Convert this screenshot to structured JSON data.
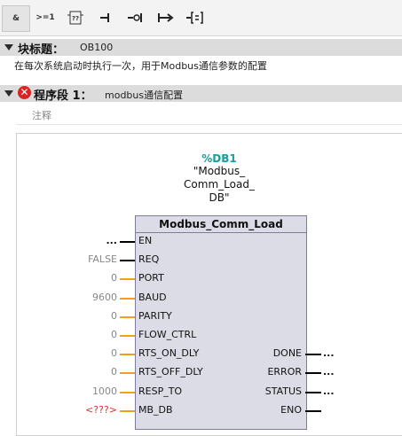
{
  "toolbar": {
    "buttons": [
      {
        "label": "&",
        "icon": "and-icon"
      },
      {
        "label": ">=1",
        "icon": "or-icon"
      },
      {
        "label": "[??]",
        "icon": "empty-box-icon"
      },
      {
        "label": "-|",
        "icon": "open-branch-icon"
      },
      {
        "label": "--o|",
        "icon": "negate-icon"
      },
      {
        "label": "|->",
        "icon": "assignment-icon"
      },
      {
        "label": "-[=]",
        "icon": "set-reset-icon"
      }
    ]
  },
  "block": {
    "title_label": "块标题：",
    "title_value": "OB100",
    "description": "在每次系统启动时执行一次，用于Modbus通信参数的配置"
  },
  "network": {
    "label": "程序段 1：",
    "title": "modbus通信配置",
    "comment_placeholder": "注释"
  },
  "instance": {
    "db_address": "%DB1",
    "db_name_lines": [
      "\"Modbus_",
      "Comm_Load_",
      "DB\""
    ]
  },
  "function_block": {
    "name": "Modbus_Comm_Load",
    "inputs": [
      {
        "name": "EN",
        "value": "..."
      },
      {
        "name": "REQ",
        "value": "FALSE"
      },
      {
        "name": "PORT",
        "value": "0"
      },
      {
        "name": "BAUD",
        "value": "9600"
      },
      {
        "name": "PARITY",
        "value": "0"
      },
      {
        "name": "FLOW_CTRL",
        "value": "0"
      },
      {
        "name": "RTS_ON_DLY",
        "value": "0"
      },
      {
        "name": "RTS_OFF_DLY",
        "value": "0"
      },
      {
        "name": "RESP_TO",
        "value": "1000"
      },
      {
        "name": "MB_DB",
        "value": "<???>"
      }
    ],
    "outputs": [
      {
        "name": "DONE",
        "value": "..."
      },
      {
        "name": "ERROR",
        "value": "..."
      },
      {
        "name": "STATUS",
        "value": "..."
      },
      {
        "name": "ENO",
        "value": ""
      }
    ]
  },
  "colors": {
    "default_value": "#888888",
    "constant_line": "#f0a020",
    "bool_line": "#000000",
    "invalid_value": "#e03030",
    "db_address": "#1a9c9c"
  }
}
